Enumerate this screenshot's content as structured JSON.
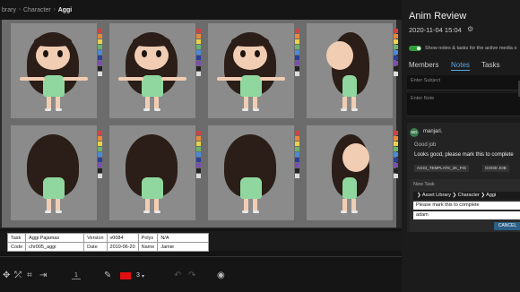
{
  "breadcrumb": {
    "items": [
      "brary",
      "Character",
      "Aggi"
    ]
  },
  "swatch_colors": [
    "#c44",
    "#e88a3a",
    "#e8d34a",
    "#6bb36b",
    "#4a8bd9",
    "#2a3f9a",
    "#7a4fb0",
    "#222222",
    "#dddddd"
  ],
  "info_table": {
    "rows": [
      [
        "Task",
        "Aggi Pajamas",
        "Version",
        "v0084",
        "Polys",
        "N/A"
      ],
      [
        "Code",
        "chr005_aggi",
        "Date",
        "2019-06-20",
        "Name",
        "Jamie"
      ]
    ]
  },
  "toolbar": {
    "frame": "1",
    "brush_size": "3",
    "color": "#e01010"
  },
  "review": {
    "title": "Anim Review",
    "date": "2020-11-04 15:04",
    "toggle_label": "Show notes & tasks for the active media o",
    "tabs": [
      "Members",
      "Notes",
      "Tasks"
    ],
    "subject_placeholder": "Enter Subject",
    "note_placeholder": "Enter Note",
    "note": {
      "initials": "MD",
      "author": "manjari.",
      "subject": "Good job",
      "body": "Looks good, please mark this to complete",
      "attachments": [
        "AGGI_TEMPLATE_2K_FIG",
        "GOOD JOB"
      ]
    },
    "new_task": {
      "title": "New Task",
      "path": [
        "Asset Library",
        "Character",
        "Aggi"
      ],
      "text": "Please mark this to complete",
      "assignee": "adam",
      "cancel_label": "CANCEL"
    }
  }
}
